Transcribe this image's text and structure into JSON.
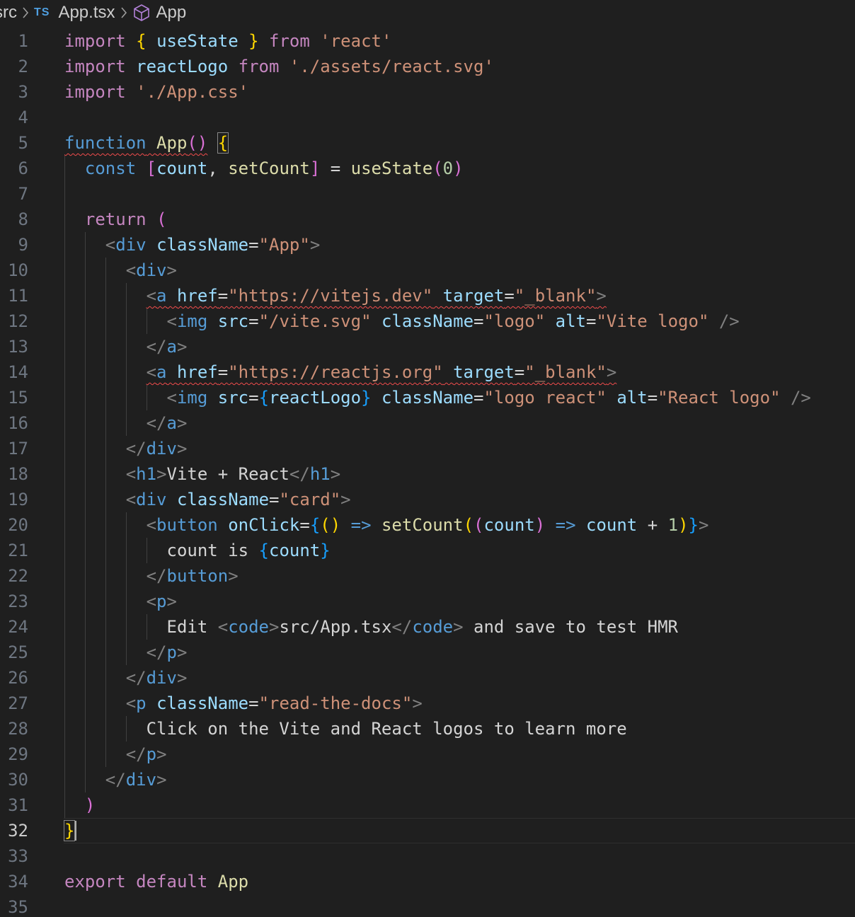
{
  "breadcrumb": {
    "folder": "src",
    "file_type_badge": "TS",
    "file": "App.tsx",
    "symbol": "App",
    "separator_icon": "chevron-right-icon",
    "symbol_icon": "cube-icon"
  },
  "editor": {
    "active_line": 32,
    "theme_colors": {
      "background": "#1f1f1f",
      "keyword": "#c586c0",
      "storage": "#569cd6",
      "function": "#dcdcaa",
      "variable": "#9cdcfe",
      "string": "#ce9178",
      "number": "#b5cea8",
      "error_squiggle": "#f14c4c"
    },
    "lines": [
      {
        "n": "1",
        "segs": [
          [
            "kw",
            "import"
          ],
          [
            "p",
            " "
          ],
          [
            "b1",
            "{"
          ],
          [
            "p",
            " "
          ],
          [
            "vr",
            "useState"
          ],
          [
            "p",
            " "
          ],
          [
            "b1",
            "}"
          ],
          [
            "p",
            " "
          ],
          [
            "kw",
            "from"
          ],
          [
            "p",
            " "
          ],
          [
            "sr",
            "'react'"
          ]
        ]
      },
      {
        "n": "2",
        "segs": [
          [
            "kw",
            "import"
          ],
          [
            "p",
            " "
          ],
          [
            "vr",
            "reactLogo"
          ],
          [
            "p",
            " "
          ],
          [
            "kw",
            "from"
          ],
          [
            "p",
            " "
          ],
          [
            "sr",
            "'./assets/react.svg'"
          ]
        ]
      },
      {
        "n": "3",
        "segs": [
          [
            "kw",
            "import"
          ],
          [
            "p",
            " "
          ],
          [
            "sr",
            "'./App.css'"
          ]
        ]
      },
      {
        "n": "4",
        "segs": []
      },
      {
        "n": "5",
        "segs": [
          [
            "st sq",
            "function"
          ],
          [
            "p sq",
            " "
          ],
          [
            "fn sq",
            "App"
          ],
          [
            "b2 sq",
            "()"
          ],
          [
            "p",
            " "
          ],
          [
            "b1 bm",
            "{"
          ]
        ]
      },
      {
        "n": "6",
        "segs": [
          [
            "p",
            "  "
          ],
          [
            "st",
            "const"
          ],
          [
            "p",
            " "
          ],
          [
            "b2",
            "["
          ],
          [
            "vr",
            "count"
          ],
          [
            "p",
            ", "
          ],
          [
            "fn",
            "setCount"
          ],
          [
            "b2",
            "]"
          ],
          [
            "p",
            " = "
          ],
          [
            "fn",
            "useState"
          ],
          [
            "b2",
            "("
          ],
          [
            "nm",
            "0"
          ],
          [
            "b2",
            ")"
          ]
        ]
      },
      {
        "n": "7",
        "segs": []
      },
      {
        "n": "8",
        "segs": [
          [
            "p",
            "  "
          ],
          [
            "kw",
            "return"
          ],
          [
            "p",
            " "
          ],
          [
            "b2",
            "("
          ]
        ]
      },
      {
        "n": "9",
        "segs": [
          [
            "p",
            "    "
          ],
          [
            "ab",
            "<"
          ],
          [
            "tg",
            "div"
          ],
          [
            "p",
            " "
          ],
          [
            "at",
            "className"
          ],
          [
            "p",
            "="
          ],
          [
            "sr",
            "\"App\""
          ],
          [
            "ab",
            ">"
          ]
        ]
      },
      {
        "n": "10",
        "segs": [
          [
            "p",
            "      "
          ],
          [
            "ab",
            "<"
          ],
          [
            "tg",
            "div"
          ],
          [
            "ab",
            ">"
          ]
        ]
      },
      {
        "n": "11",
        "segs": [
          [
            "p",
            "        "
          ],
          [
            "ab sq",
            "<"
          ],
          [
            "tg sq",
            "a"
          ],
          [
            "p sq",
            " "
          ],
          [
            "at sq",
            "href"
          ],
          [
            "p sq",
            "="
          ],
          [
            "sr sq",
            "\"https://vitejs.dev\""
          ],
          [
            "p sq",
            " "
          ],
          [
            "at sq",
            "target"
          ],
          [
            "p sq",
            "="
          ],
          [
            "sr sq",
            "\"_blank\""
          ],
          [
            "ab sq",
            ">"
          ]
        ]
      },
      {
        "n": "12",
        "segs": [
          [
            "p",
            "          "
          ],
          [
            "ab",
            "<"
          ],
          [
            "tg",
            "img"
          ],
          [
            "p",
            " "
          ],
          [
            "at",
            "src"
          ],
          [
            "p",
            "="
          ],
          [
            "sr",
            "\"/vite.svg\""
          ],
          [
            "p",
            " "
          ],
          [
            "at",
            "className"
          ],
          [
            "p",
            "="
          ],
          [
            "sr",
            "\"logo\""
          ],
          [
            "p",
            " "
          ],
          [
            "at",
            "alt"
          ],
          [
            "p",
            "="
          ],
          [
            "sr",
            "\"Vite logo\""
          ],
          [
            "p",
            " "
          ],
          [
            "ab",
            "/>"
          ]
        ]
      },
      {
        "n": "13",
        "segs": [
          [
            "p",
            "        "
          ],
          [
            "ab",
            "</"
          ],
          [
            "tg",
            "a"
          ],
          [
            "ab",
            ">"
          ]
        ]
      },
      {
        "n": "14",
        "segs": [
          [
            "p",
            "        "
          ],
          [
            "ab sq",
            "<"
          ],
          [
            "tg sq",
            "a"
          ],
          [
            "p sq",
            " "
          ],
          [
            "at sq",
            "href"
          ],
          [
            "p sq",
            "="
          ],
          [
            "sr sq",
            "\"https://reactjs.org\""
          ],
          [
            "p sq",
            " "
          ],
          [
            "at sq",
            "target"
          ],
          [
            "p sq",
            "="
          ],
          [
            "sr sq",
            "\"_blank\""
          ],
          [
            "ab sq",
            ">"
          ]
        ]
      },
      {
        "n": "15",
        "segs": [
          [
            "p",
            "          "
          ],
          [
            "ab",
            "<"
          ],
          [
            "tg",
            "img"
          ],
          [
            "p",
            " "
          ],
          [
            "at",
            "src"
          ],
          [
            "p",
            "="
          ],
          [
            "b3",
            "{"
          ],
          [
            "vr",
            "reactLogo"
          ],
          [
            "b3",
            "}"
          ],
          [
            "p",
            " "
          ],
          [
            "at",
            "className"
          ],
          [
            "p",
            "="
          ],
          [
            "sr",
            "\"logo react\""
          ],
          [
            "p",
            " "
          ],
          [
            "at",
            "alt"
          ],
          [
            "p",
            "="
          ],
          [
            "sr",
            "\"React logo\""
          ],
          [
            "p",
            " "
          ],
          [
            "ab",
            "/>"
          ]
        ]
      },
      {
        "n": "16",
        "segs": [
          [
            "p",
            "        "
          ],
          [
            "ab",
            "</"
          ],
          [
            "tg",
            "a"
          ],
          [
            "ab",
            ">"
          ]
        ]
      },
      {
        "n": "17",
        "segs": [
          [
            "p",
            "      "
          ],
          [
            "ab",
            "</"
          ],
          [
            "tg",
            "div"
          ],
          [
            "ab",
            ">"
          ]
        ]
      },
      {
        "n": "18",
        "segs": [
          [
            "p",
            "      "
          ],
          [
            "ab",
            "<"
          ],
          [
            "tg",
            "h1"
          ],
          [
            "ab",
            ">"
          ],
          [
            "tx",
            "Vite + React"
          ],
          [
            "ab",
            "</"
          ],
          [
            "tg",
            "h1"
          ],
          [
            "ab",
            ">"
          ]
        ]
      },
      {
        "n": "19",
        "segs": [
          [
            "p",
            "      "
          ],
          [
            "ab",
            "<"
          ],
          [
            "tg",
            "div"
          ],
          [
            "p",
            " "
          ],
          [
            "at",
            "className"
          ],
          [
            "p",
            "="
          ],
          [
            "sr",
            "\"card\""
          ],
          [
            "ab",
            ">"
          ]
        ]
      },
      {
        "n": "20",
        "segs": [
          [
            "p",
            "        "
          ],
          [
            "ab",
            "<"
          ],
          [
            "tg",
            "button"
          ],
          [
            "p",
            " "
          ],
          [
            "at",
            "onClick"
          ],
          [
            "p",
            "="
          ],
          [
            "b3",
            "{"
          ],
          [
            "b1",
            "()"
          ],
          [
            "p",
            " "
          ],
          [
            "st",
            "=>"
          ],
          [
            "p",
            " "
          ],
          [
            "fn",
            "setCount"
          ],
          [
            "b1",
            "("
          ],
          [
            "b2",
            "("
          ],
          [
            "vr",
            "count"
          ],
          [
            "b2",
            ")"
          ],
          [
            "p",
            " "
          ],
          [
            "st",
            "=>"
          ],
          [
            "p",
            " "
          ],
          [
            "vr",
            "count"
          ],
          [
            "p",
            " + "
          ],
          [
            "nm",
            "1"
          ],
          [
            "b1",
            ")"
          ],
          [
            "b3",
            "}"
          ],
          [
            "ab",
            ">"
          ]
        ]
      },
      {
        "n": "21",
        "segs": [
          [
            "p",
            "          "
          ],
          [
            "tx",
            "count is "
          ],
          [
            "b3",
            "{"
          ],
          [
            "vr",
            "count"
          ],
          [
            "b3",
            "}"
          ]
        ]
      },
      {
        "n": "22",
        "segs": [
          [
            "p",
            "        "
          ],
          [
            "ab",
            "</"
          ],
          [
            "tg",
            "button"
          ],
          [
            "ab",
            ">"
          ]
        ]
      },
      {
        "n": "23",
        "segs": [
          [
            "p",
            "        "
          ],
          [
            "ab",
            "<"
          ],
          [
            "tg",
            "p"
          ],
          [
            "ab",
            ">"
          ]
        ]
      },
      {
        "n": "24",
        "segs": [
          [
            "p",
            "          "
          ],
          [
            "tx",
            "Edit "
          ],
          [
            "ab",
            "<"
          ],
          [
            "tg",
            "code"
          ],
          [
            "ab",
            ">"
          ],
          [
            "tx",
            "src/App.tsx"
          ],
          [
            "ab",
            "</"
          ],
          [
            "tg",
            "code"
          ],
          [
            "ab",
            ">"
          ],
          [
            "tx",
            " and save to test HMR"
          ]
        ]
      },
      {
        "n": "25",
        "segs": [
          [
            "p",
            "        "
          ],
          [
            "ab",
            "</"
          ],
          [
            "tg",
            "p"
          ],
          [
            "ab",
            ">"
          ]
        ]
      },
      {
        "n": "26",
        "segs": [
          [
            "p",
            "      "
          ],
          [
            "ab",
            "</"
          ],
          [
            "tg",
            "div"
          ],
          [
            "ab",
            ">"
          ]
        ]
      },
      {
        "n": "27",
        "segs": [
          [
            "p",
            "      "
          ],
          [
            "ab",
            "<"
          ],
          [
            "tg",
            "p"
          ],
          [
            "p",
            " "
          ],
          [
            "at",
            "className"
          ],
          [
            "p",
            "="
          ],
          [
            "sr",
            "\"read-the-docs\""
          ],
          [
            "ab",
            ">"
          ]
        ]
      },
      {
        "n": "28",
        "segs": [
          [
            "p",
            "        "
          ],
          [
            "tx",
            "Click on the Vite and React logos to learn more"
          ]
        ]
      },
      {
        "n": "29",
        "segs": [
          [
            "p",
            "      "
          ],
          [
            "ab",
            "</"
          ],
          [
            "tg",
            "p"
          ],
          [
            "ab",
            ">"
          ]
        ]
      },
      {
        "n": "30",
        "segs": [
          [
            "p",
            "    "
          ],
          [
            "ab",
            "</"
          ],
          [
            "tg",
            "div"
          ],
          [
            "ab",
            ">"
          ]
        ]
      },
      {
        "n": "31",
        "segs": [
          [
            "p",
            "  "
          ],
          [
            "b2",
            ")"
          ]
        ]
      },
      {
        "n": "32",
        "segs": [
          [
            "b1 bm",
            "}"
          ]
        ]
      },
      {
        "n": "33",
        "segs": []
      },
      {
        "n": "34",
        "segs": [
          [
            "kw",
            "export"
          ],
          [
            "p",
            " "
          ],
          [
            "kw",
            "default"
          ],
          [
            "p",
            " "
          ],
          [
            "fn",
            "App"
          ]
        ]
      },
      {
        "n": "35",
        "segs": []
      }
    ]
  }
}
